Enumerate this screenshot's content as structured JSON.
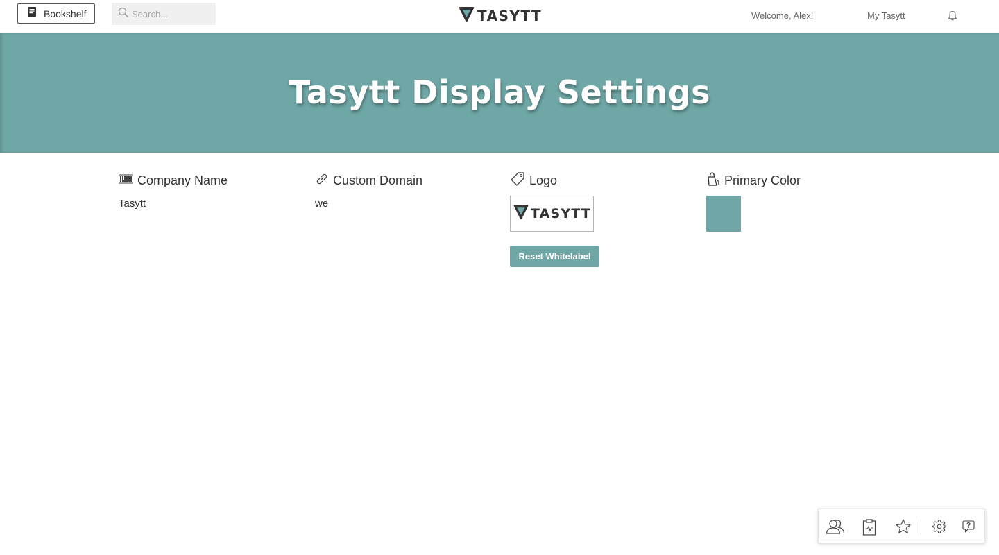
{
  "nav": {
    "bookshelf_label": "Bookshelf",
    "bookshelf_icon": "book-icon",
    "search_placeholder": "Search...",
    "search_icon": "search-icon",
    "brand": "TASYTT",
    "welcome": "Welcome, Alex!",
    "my_link": "My Tasytt",
    "bell_icon": "bell-icon"
  },
  "hero": {
    "title": "Tasytt Display Settings",
    "background": "#6fa7a7"
  },
  "settings": {
    "company": {
      "label": "Company Name",
      "icon": "keyboard-icon",
      "value": "Tasytt"
    },
    "domain": {
      "label": "Custom Domain",
      "icon": "link-icon",
      "value": "we"
    },
    "logo": {
      "label": "Logo",
      "icon": "tag-icon",
      "logo_text": "TASYTT",
      "reset_label": "Reset Whitelabel"
    },
    "color": {
      "label": "Primary Color",
      "icon": "paint-bucket-icon",
      "value": "#6fa7a7"
    }
  },
  "dock": {
    "icons": [
      "users-icon",
      "clipboard-activity-icon",
      "star-icon",
      "gear-icon",
      "help-bubble-icon"
    ]
  }
}
